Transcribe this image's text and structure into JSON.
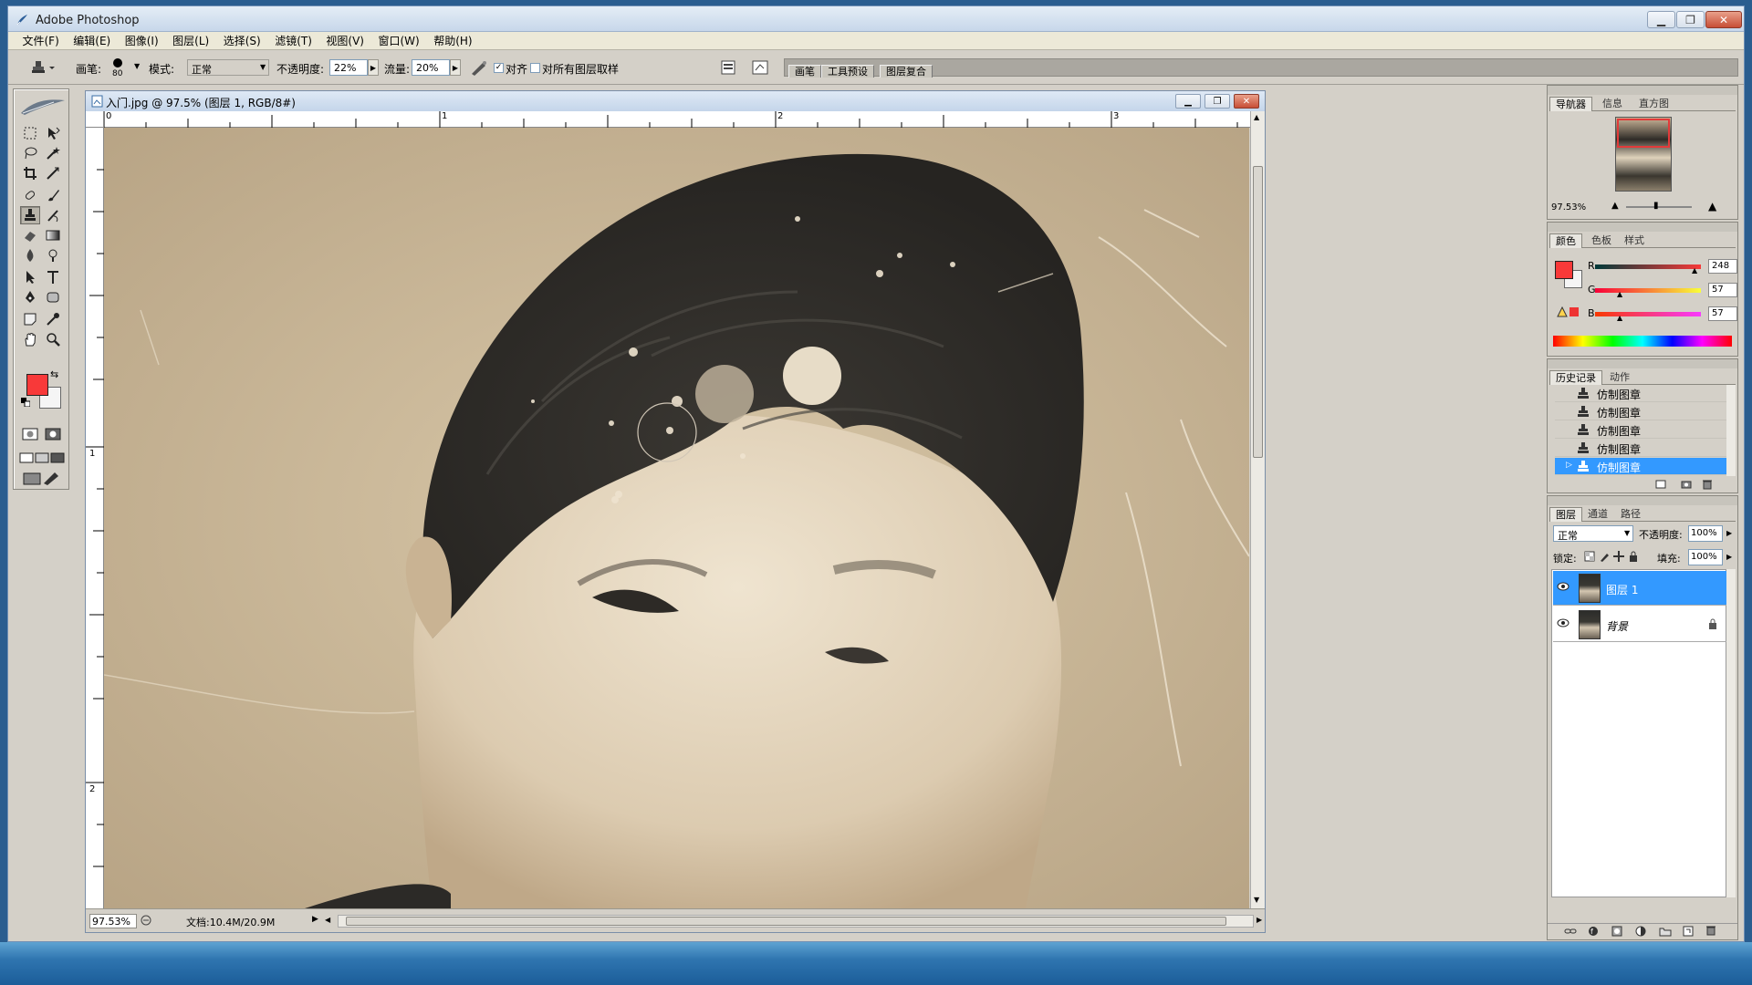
{
  "window": {
    "title": "Adobe Photoshop"
  },
  "menu": [
    "文件(F)",
    "编辑(E)",
    "图像(I)",
    "图层(L)",
    "选择(S)",
    "滤镜(T)",
    "视图(V)",
    "窗口(W)",
    "帮助(H)"
  ],
  "options": {
    "brush_label": "画笔:",
    "brush_size": "80",
    "mode_label": "模式:",
    "mode_value": "正常",
    "opacity_label": "不透明度:",
    "opacity_value": "22%",
    "flow_label": "流量:",
    "flow_value": "20%",
    "aligned_label": "对齐",
    "aligned_checked": true,
    "all_layers_label": "对所有图层取样",
    "all_layers_checked": false
  },
  "palette_well_tabs": [
    "画笔",
    "工具预设",
    "图层复合"
  ],
  "toolbox": {
    "foreground_color": "#f83939",
    "background_color": "#f5f5f5"
  },
  "document": {
    "title": "入门.jpg @ 97.5% (图层 1, RGB/8#)",
    "ruler_top_labels": [
      "0",
      "1",
      "2",
      "3"
    ],
    "ruler_left_labels": [
      "1",
      "2"
    ],
    "zoom": "97.53%",
    "doc_size": "文档:10.4M/20.9M"
  },
  "navigator": {
    "tabs": [
      "导航器",
      "信息",
      "直方图"
    ],
    "zoom": "97.53%"
  },
  "color_panel": {
    "tabs": [
      "颜色",
      "色板",
      "样式"
    ],
    "channels": [
      {
        "label": "R",
        "value": "248"
      },
      {
        "label": "G",
        "value": "57"
      },
      {
        "label": "B",
        "value": "57"
      }
    ],
    "swatch": "#f83939"
  },
  "history_panel": {
    "tabs": [
      "历史记录",
      "动作"
    ],
    "items": [
      "仿制图章",
      "仿制图章",
      "仿制图章",
      "仿制图章",
      "仿制图章"
    ],
    "selected_index": 4
  },
  "layers_panel": {
    "tabs": [
      "图层",
      "通道",
      "路径"
    ],
    "blend_mode": "正常",
    "opacity_label": "不透明度:",
    "opacity_value": "100%",
    "lock_label": "锁定:",
    "fill_label": "填充:",
    "fill_value": "100%",
    "layers": [
      {
        "name": "图层 1",
        "selected": true,
        "locked": false
      },
      {
        "name": "背景",
        "selected": false,
        "locked": true
      }
    ]
  }
}
